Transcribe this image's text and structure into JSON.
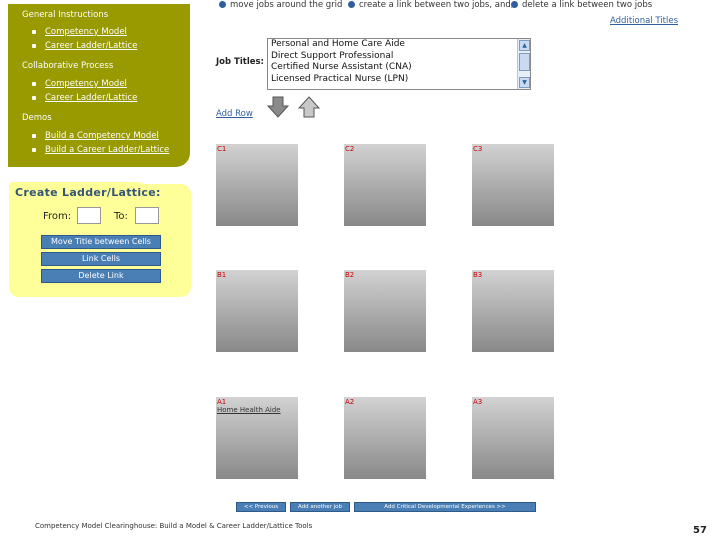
{
  "nav": {
    "general_instructions": "General Instructions",
    "general_items": [
      "Competency Model",
      "Career Ladder/Lattice"
    ],
    "collaborative_process": "Collaborative Process",
    "collab_items": [
      "Competency Model",
      "Career Ladder/Lattice"
    ],
    "demos": "Demos",
    "demo_items": [
      "Build a Competency Model",
      "Build a Career Ladder/Lattice"
    ]
  },
  "ladder": {
    "title": "Create Ladder/Lattice:",
    "from_label": "From:",
    "to_label": "To:",
    "buttons": [
      "Move Title between Cells",
      "Link Cells",
      "Delete Link"
    ]
  },
  "instructions": [
    "move jobs around the grid",
    "create a link between two jobs, and;",
    "delete a link between two jobs"
  ],
  "additional_titles": "Additional Titles",
  "job_titles": {
    "label": "Job Titles:",
    "options": [
      "Personal and Home Care Aide",
      "Direct Support Professional",
      "Certified Nurse Assistant (CNA)",
      "Licensed Practical Nurse (LPN)"
    ]
  },
  "add_row": "Add Row",
  "grid": {
    "labels": [
      "C1",
      "C2",
      "C3",
      "B1",
      "B2",
      "B3",
      "A1",
      "A2",
      "A3"
    ],
    "a1_job": "Home Health Aide"
  },
  "bottom_nav": [
    "<< Previous",
    "Add another job",
    "Add Critical Developmental Experiences >>"
  ],
  "footer": "Competency Model Clearinghouse: Build a Model & Career Ladder/Lattice Tools",
  "page_number": "57",
  "colors": {
    "nav_bg": "#999900",
    "ladder_bg": "#ffff99",
    "button_blue": "#4a7fb5",
    "cell_label_red": "#cc0000"
  }
}
